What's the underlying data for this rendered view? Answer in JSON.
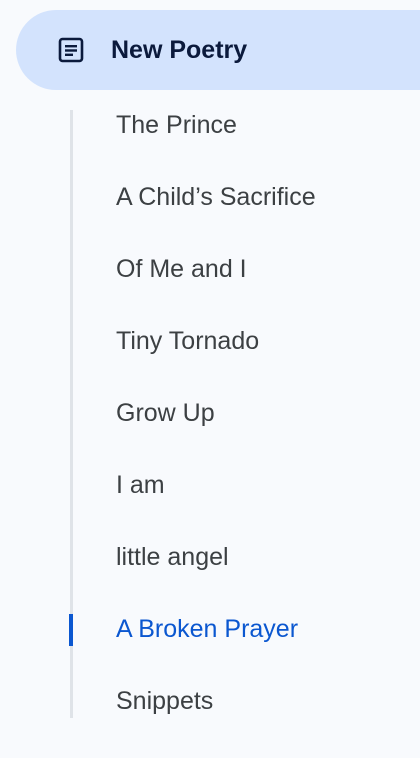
{
  "outline": {
    "document": {
      "title": "New Poetry",
      "icon": "document-lines-icon"
    },
    "headings": [
      {
        "label": "The Prince",
        "active": false
      },
      {
        "label": "A Child’s Sacrifice",
        "active": false
      },
      {
        "label": "Of Me and I",
        "active": false
      },
      {
        "label": "Tiny Tornado",
        "active": false
      },
      {
        "label": "Grow Up",
        "active": false
      },
      {
        "label": "I am",
        "active": false
      },
      {
        "label": "little angel",
        "active": false
      },
      {
        "label": "A Broken Prayer",
        "active": true
      },
      {
        "label": "Snippets",
        "active": false
      }
    ],
    "colors": {
      "header_bg": "#d3e3fd",
      "active_text": "#0b57d0",
      "text": "#3c4043",
      "track": "#dfe3e8"
    }
  }
}
